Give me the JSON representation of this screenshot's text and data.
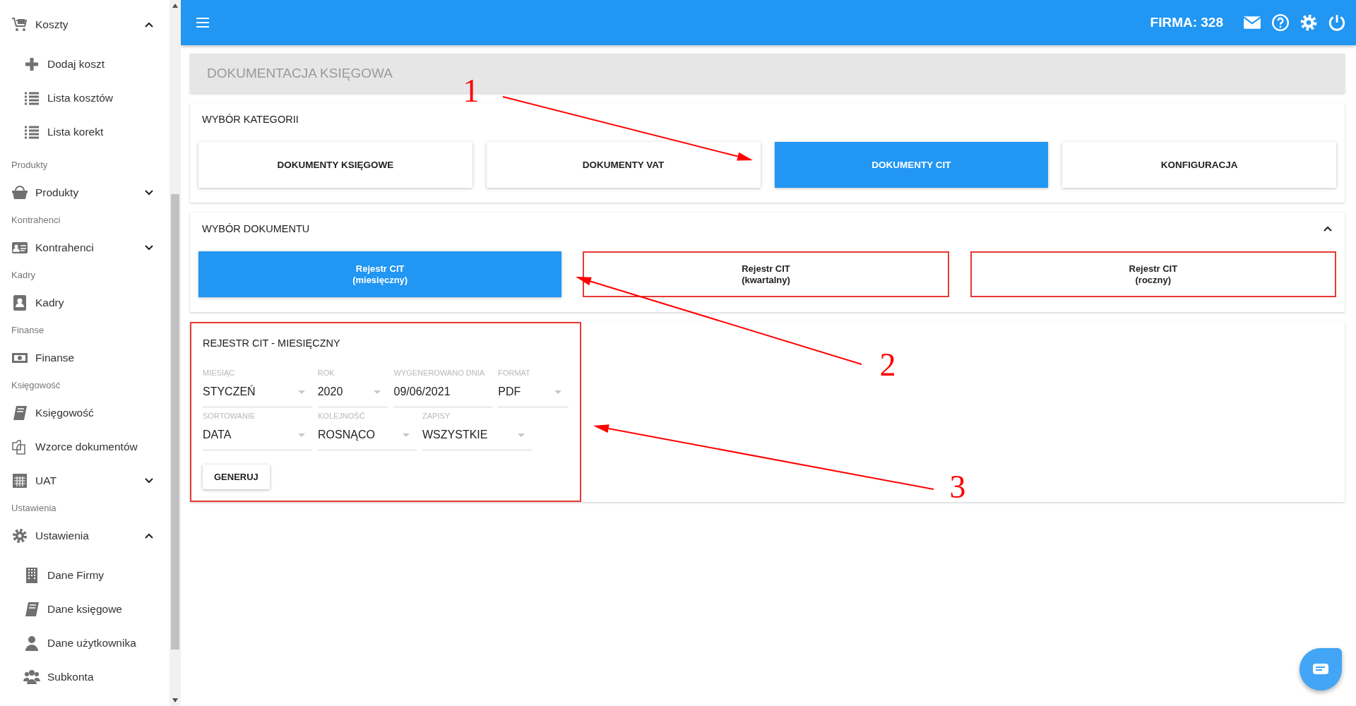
{
  "sidebar": {
    "items": [
      {
        "kind": "item",
        "label": "Koszty",
        "expanded": true
      },
      {
        "kind": "subitem",
        "label": "Dodaj koszt"
      },
      {
        "kind": "subitem",
        "label": "Lista kosztów"
      },
      {
        "kind": "subitem",
        "label": "Lista korekt"
      },
      {
        "kind": "header",
        "label": "Produkty"
      },
      {
        "kind": "item",
        "label": "Produkty",
        "expanded": false
      },
      {
        "kind": "header",
        "label": "Kontrahenci"
      },
      {
        "kind": "item",
        "label": "Kontrahenci",
        "expanded": false
      },
      {
        "kind": "header",
        "label": "Kadry"
      },
      {
        "kind": "item",
        "label": "Kadry"
      },
      {
        "kind": "header",
        "label": "Finanse"
      },
      {
        "kind": "item",
        "label": "Finanse"
      },
      {
        "kind": "header",
        "label": "Księgowość"
      },
      {
        "kind": "item",
        "label": "Księgowość"
      },
      {
        "kind": "item",
        "label": "Wzorce dokumentów"
      },
      {
        "kind": "item",
        "label": "UAT",
        "expanded": false
      },
      {
        "kind": "header",
        "label": "Ustawienia"
      },
      {
        "kind": "item",
        "label": "Ustawienia",
        "expanded": true
      },
      {
        "kind": "subitem",
        "label": "Dane Firmy"
      },
      {
        "kind": "subitem",
        "label": "Dane księgowe"
      },
      {
        "kind": "subitem",
        "label": "Dane użytkownika"
      },
      {
        "kind": "subitem",
        "label": "Subkonta"
      }
    ]
  },
  "topbar": {
    "company": "FIRMA: 328"
  },
  "page_title": "DOKUMENTACJA KSIĘGOWA",
  "categories": {
    "title": "WYBÓR KATEGORII",
    "items": [
      {
        "label": "DOKUMENTY KSIĘGOWE",
        "selected": false
      },
      {
        "label": "DOKUMENTY VAT",
        "selected": false
      },
      {
        "label": "DOKUMENTY CIT",
        "selected": true
      },
      {
        "label": "KONFIGURACJA",
        "selected": false
      }
    ]
  },
  "documents": {
    "title": "WYBÓR DOKUMENTU",
    "expanded": true,
    "items": [
      {
        "label": "Rejestr CIT",
        "sub": "(miesięczny)",
        "selected": true,
        "highlighted": false
      },
      {
        "label": "Rejestr CIT",
        "sub": "(kwartalny)",
        "selected": false,
        "highlighted": true
      },
      {
        "label": "Rejestr CIT",
        "sub": "(roczny)",
        "selected": false,
        "highlighted": true
      }
    ]
  },
  "form": {
    "title": "REJESTR CIT - MIESIĘCZNY",
    "highlighted": true,
    "rows": [
      [
        {
          "kind": "select",
          "label": "MIESIĄC",
          "value": "STYCZEŃ"
        },
        {
          "kind": "select",
          "label": "ROK",
          "value": "2020"
        },
        {
          "kind": "date",
          "label": "WYGENEROWANO DNIA",
          "value": "09/06/2021"
        },
        {
          "kind": "select",
          "label": "FORMAT",
          "value": "PDF"
        }
      ],
      [
        {
          "kind": "select",
          "label": "SORTOWANIE",
          "value": "DATA"
        },
        {
          "kind": "select",
          "label": "KOLEJNOŚĆ",
          "value": "ROSNĄCO"
        },
        {
          "kind": "select",
          "label": "ZAPISY",
          "value": "WSZYSTKIE"
        }
      ]
    ],
    "button": "GENERUJ"
  },
  "annotations": [
    {
      "label": "1"
    },
    {
      "label": "2"
    },
    {
      "label": "3"
    }
  ]
}
